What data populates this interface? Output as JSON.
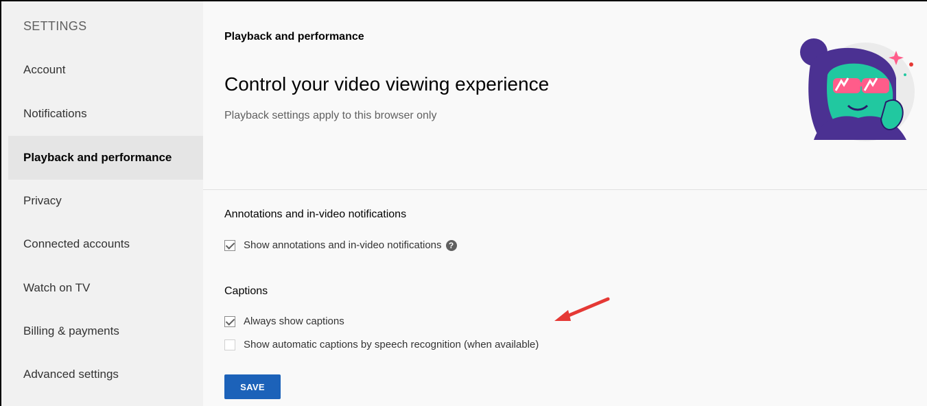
{
  "sidebar": {
    "heading": "SETTINGS",
    "items": [
      {
        "label": "Account"
      },
      {
        "label": "Notifications"
      },
      {
        "label": "Playback and performance",
        "active": true
      },
      {
        "label": "Privacy"
      },
      {
        "label": "Connected accounts"
      },
      {
        "label": "Watch on TV"
      },
      {
        "label": "Billing & payments"
      },
      {
        "label": "Advanced settings"
      }
    ]
  },
  "main": {
    "page_title": "Playback and performance",
    "hero_title": "Control your video viewing experience",
    "hero_subtitle": "Playback settings apply to this browser only",
    "annotations": {
      "title": "Annotations and in-video notifications",
      "option_label": "Show annotations and in-video notifications",
      "option_checked": true
    },
    "captions": {
      "title": "Captions",
      "always_show_label": "Always show captions",
      "always_show_checked": true,
      "auto_captions_label": "Show automatic captions by speech recognition (when available)",
      "auto_captions_checked": false
    },
    "save_label": "SAVE",
    "help_icon_glyph": "?"
  },
  "colors": {
    "accent": "#1c62b9",
    "annotation_arrow": "#e53935"
  }
}
